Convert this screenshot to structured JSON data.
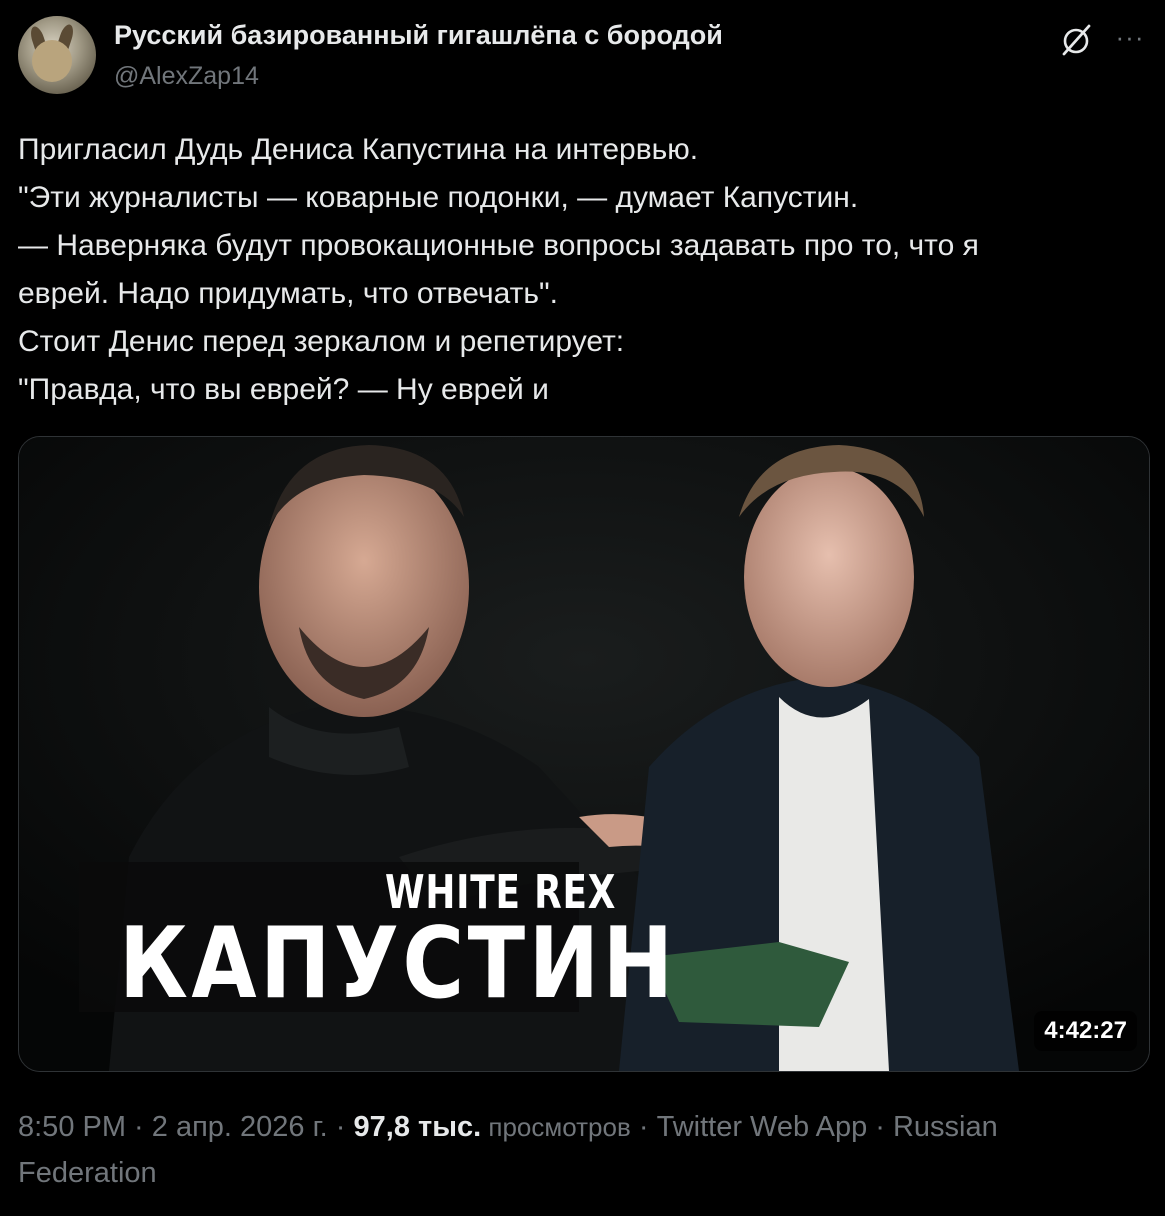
{
  "author": {
    "display_name": "Русский базированный гигашлёпа с бородой",
    "handle": "@AlexZap14"
  },
  "tweet": {
    "lines": [
      "Пригласил Дудь Дениса Капустина на интервью.",
      "\"Эти журналисты — коварные подонки, — думает Капустин.",
      "— Наверняка будут провокационные вопросы задавать про то, что я",
      "еврей. Надо придумать, что отвечать\".",
      "Стоит Денис перед зеркалом и репетирует:",
      "\"Правда, что вы еврей? — Ну еврей и"
    ]
  },
  "media": {
    "overlay_top": "WHITE REX",
    "overlay_main": "КАПУСТИН",
    "duration": "4:42:27"
  },
  "meta": {
    "time": "8:50 PM",
    "sep1": " · ",
    "date": "2 апр. 2026 г.",
    "sep2": " · ",
    "views_count": "97,8 тыс.",
    "views_label": " просмотров",
    "sep3": " · ",
    "source": "Twitter Web App",
    "sep4": " · ",
    "location_part1": "Russian",
    "location_part2": "Federation"
  },
  "icons": {
    "grok": "grok-icon",
    "more": "more-icon"
  }
}
